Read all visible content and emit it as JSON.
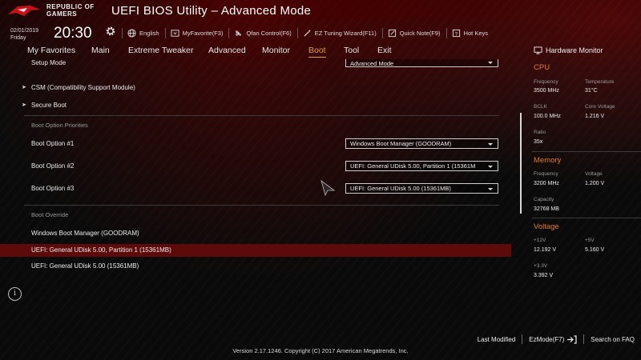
{
  "header": {
    "brand_line1": "REPUBLIC OF",
    "brand_line2": "GAMERS",
    "title": "UEFI BIOS Utility – Advanced Mode",
    "date": "02/01/2019",
    "day": "Friday",
    "time": "20:30"
  },
  "toolbar": [
    {
      "label": "English",
      "icon": "globe-icon"
    },
    {
      "label": "MyFavorite(F3)",
      "icon": "favorite-icon"
    },
    {
      "label": "Qfan Control(F6)",
      "icon": "fan-icon"
    },
    {
      "label": "EZ Tuning Wizard(F11)",
      "icon": "wizard-icon"
    },
    {
      "label": "Quick Note(F9)",
      "icon": "note-icon"
    },
    {
      "label": "Hot Keys",
      "icon": "help-icon"
    }
  ],
  "tabs": [
    "My Favorites",
    "Main",
    "Extreme Tweaker",
    "Advanced",
    "Monitor",
    "Boot",
    "Tool",
    "Exit"
  ],
  "active_tab": "Boot",
  "main": {
    "setup_mode_label": "Setup Mode",
    "setup_mode_value": "Advanced Mode",
    "csm_label": "CSM (Compatibility Support Module)",
    "secure_boot_label": "Secure Boot",
    "boot_priorities_heading": "Boot Option Priorities",
    "boot_options": [
      {
        "label": "Boot Option #1",
        "value": "Windows Boot Manager (GOODRAM)"
      },
      {
        "label": "Boot Option #2",
        "value": "UEFI: General UDisk 5.00, Partition 1 (15361M"
      },
      {
        "label": "Boot Option #3",
        "value": "UEFI: General UDisk 5.00 (15361MB)"
      }
    ],
    "boot_override_heading": "Boot Override",
    "boot_override_items": [
      "Windows Boot Manager (GOODRAM)",
      "UEFI: General UDisk 5.00, Partition 1 (15361MB)",
      "UEFI: General UDisk 5.00 (15361MB)"
    ]
  },
  "hardware_monitor": {
    "title": "Hardware Monitor",
    "cpu": {
      "heading": "CPU",
      "frequency_label": "Frequency",
      "frequency": "3500 MHz",
      "temperature_label": "Temperature",
      "temperature": "31°C",
      "bclk_label": "BCLK",
      "bclk": "100.0 MHz",
      "core_voltage_label": "Core Voltage",
      "core_voltage": "1.216 V",
      "ratio_label": "Ratio",
      "ratio": "35x"
    },
    "memory": {
      "heading": "Memory",
      "frequency_label": "Frequency",
      "frequency": "3200 MHz",
      "voltage_label": "Voltage",
      "voltage": "1.200 V",
      "capacity_label": "Capacity",
      "capacity": "32768 MB"
    },
    "voltage": {
      "heading": "Voltage",
      "v12_label": "+12V",
      "v12": "12.192 V",
      "v5_label": "+5V",
      "v5": "5.160 V",
      "v33_label": "+3.3V",
      "v33": "3.392 V"
    }
  },
  "footer": {
    "last_modified": "Last Modified",
    "ezmode": "EzMode(F7)",
    "search_faq": "Search on FAQ",
    "version": "Version 2.17.1246. Copyright (C) 2017 American Megatrends, Inc."
  },
  "colors": {
    "accent_tab": "#d9a233",
    "hw_heading": "#e07b2d",
    "highlight_row": "#5c0a0a"
  }
}
